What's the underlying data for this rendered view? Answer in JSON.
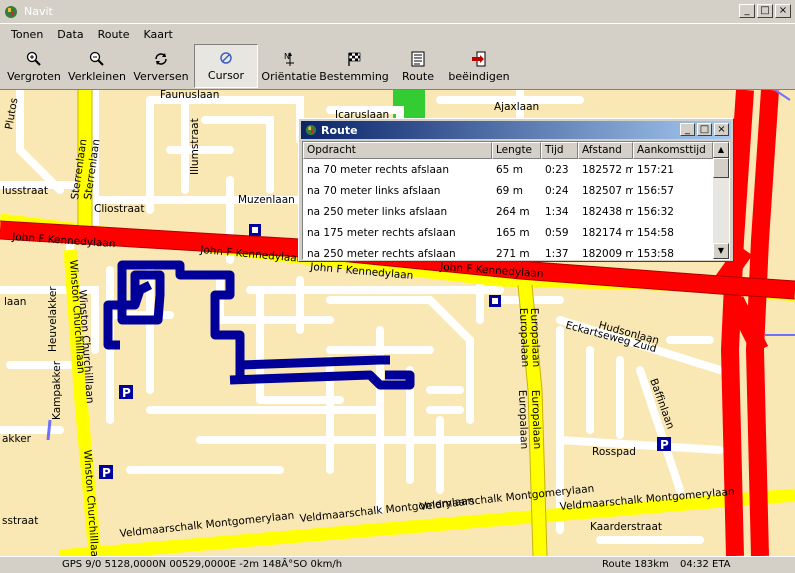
{
  "window": {
    "title": "Navit"
  },
  "menu": [
    "Tonen",
    "Data",
    "Route",
    "Kaart"
  ],
  "toolbar": [
    {
      "label": "Vergroten",
      "icon": "zoom-in-icon"
    },
    {
      "label": "Verkleinen",
      "icon": "zoom-out-icon"
    },
    {
      "label": "Verversen",
      "icon": "refresh-icon"
    },
    {
      "label": "Cursor",
      "icon": "cursor-icon"
    },
    {
      "label": "Oriëntatie",
      "icon": "orientation-icon"
    },
    {
      "label": "Bestemming",
      "icon": "destination-flag-icon"
    },
    {
      "label": "Route",
      "icon": "route-list-icon"
    },
    {
      "label": "beëindigen",
      "icon": "exit-icon"
    }
  ],
  "route_dialog": {
    "title": "Route",
    "columns": [
      "Opdracht",
      "Lengte",
      "Tijd",
      "Afstand",
      "Aankomsttijd"
    ],
    "rows": [
      [
        "na 70 meter rechts afslaan",
        "65 m",
        "0:23",
        "182572 m",
        "157:21"
      ],
      [
        "na 70 meter links afslaan",
        "69 m",
        "0:24",
        "182507 m",
        "156:57"
      ],
      [
        "na 250 meter links afslaan",
        "264 m",
        "1:34",
        "182438 m",
        "156:32"
      ],
      [
        "na 175 meter rechts afslaan",
        "165 m",
        "0:59",
        "182174 m",
        "154:58"
      ],
      [
        "na 250 meter rechts afslaan",
        "271 m",
        "1:37",
        "182009 m",
        "153:58"
      ]
    ]
  },
  "status": {
    "gps": "GPS  9/0 5128,0000N 00529,0000E   -2m 148Â°SO   0km/h",
    "route": "Route  183km",
    "eta": "04:32 ETA"
  },
  "map_labels": {
    "plutos": "Plutos",
    "faunuslaan": "Faunuslaan",
    "icaruslaan": "Icaruslaan",
    "ajaxlaan": "Ajaxlaan",
    "sterrenlaan": "Sterrenlaan",
    "illumstraat": "Illumstraat",
    "clusstraat": "lusstraat",
    "cliostraat": "Cliostraat",
    "muzenlaan": "Muzenlaan",
    "jfk": "John F Kennedylaan",
    "bestlaan": "laan",
    "kampakker": "Kampakker",
    "heuvelakker": "Heuvelakker",
    "winston": "Winston Churchilllaan",
    "europalaan": "Europalaan",
    "hudsonlaan": "Hudsonlaan",
    "eckartseweg": "Eckartseweg Zuid",
    "baffinlaan": "Baffinlaan",
    "rosspad": "Rosspad",
    "montgomery": "Veldmaarschalk Montgomerylaan",
    "kaarderstraat": "Kaarderstraat",
    "akker": "akker",
    "hsstraat": "sstraat"
  },
  "colors": {
    "map_background": "#f9e8b4",
    "highway": "#ff0000",
    "main_road": "#ffff00",
    "route": "#0000a0",
    "park": "#33cc33",
    "title_bar": "#0a246a"
  }
}
